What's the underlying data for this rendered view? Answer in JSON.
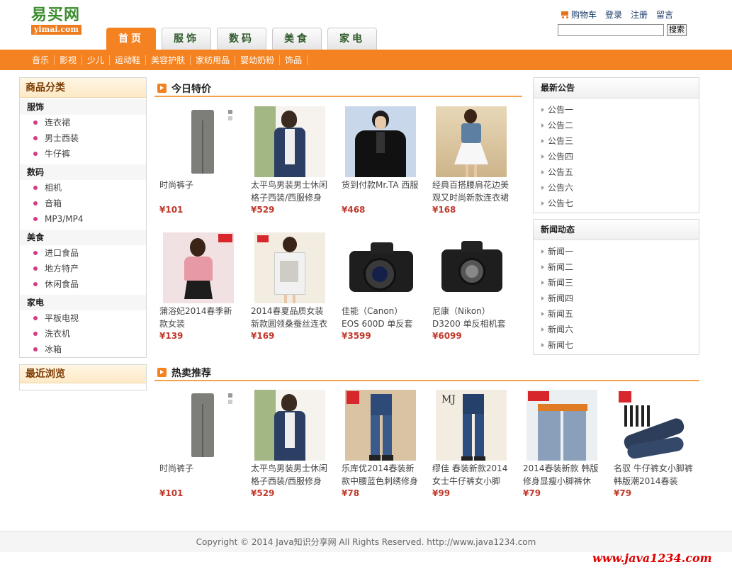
{
  "header": {
    "logo_cn": "易买网",
    "logo_en": "yimai.com",
    "links": [
      "购物车",
      "登录",
      "注册",
      "留言"
    ],
    "search_placeholder": "",
    "search_button": "搜索"
  },
  "tabs": [
    {
      "label": "首页",
      "active": true
    },
    {
      "label": "服饰",
      "active": false
    },
    {
      "label": "数码",
      "active": false
    },
    {
      "label": "美食",
      "active": false
    },
    {
      "label": "家电",
      "active": false
    }
  ],
  "subnav": [
    "音乐",
    "影视",
    "少儿",
    "运动鞋",
    "美容护肤",
    "家纺用品",
    "婴幼奶粉",
    "饰品"
  ],
  "categories": {
    "title": "商品分类",
    "groups": [
      {
        "name": "服饰",
        "items": [
          "连衣裙",
          "男士西装",
          "牛仔裤"
        ]
      },
      {
        "name": "数码",
        "items": [
          "相机",
          "音箱",
          "MP3/MP4"
        ]
      },
      {
        "name": "美食",
        "items": [
          "进口食品",
          "地方特产",
          "休闲食品"
        ]
      },
      {
        "name": "家电",
        "items": [
          "平板电视",
          "洗衣机",
          "冰箱"
        ]
      }
    ]
  },
  "recent": {
    "title": "最近浏览"
  },
  "deals": {
    "title": "今日特价",
    "products": [
      {
        "name": "时尚裤子",
        "price": "¥101"
      },
      {
        "name": "太平鸟男装男士休闲格子西装/西服修身",
        "price": "¥529"
      },
      {
        "name": "货到付款Mr.TA 西服",
        "price": "¥468"
      },
      {
        "name": "经典百搭腰肩花边美观又时尚新款连衣裙",
        "price": "¥168"
      },
      {
        "name": "蒲浴妃2014春季新款女装",
        "price": "¥139"
      },
      {
        "name": "2014春夏品质女装新款圆领桑蚕丝连衣",
        "price": "¥169"
      },
      {
        "name": "佳能（Canon） EOS 600D 单反套机",
        "price": "¥3599"
      },
      {
        "name": "尼康（Nikon） D3200 单反相机套机",
        "price": "¥6099"
      }
    ]
  },
  "hot": {
    "title": "热卖推荐",
    "products": [
      {
        "name": "时尚裤子",
        "price": "¥101"
      },
      {
        "name": "太平鸟男装男士休闲格子西装/西服修身",
        "price": "¥529"
      },
      {
        "name": "乐库优2014春装新款中腰蓝色刺绣修身",
        "price": "¥78"
      },
      {
        "name": "缪佳 春装新款2014女士牛仔裤女小脚",
        "price": "¥99"
      },
      {
        "name": "2014春装新款 韩版修身显瘦小脚裤休",
        "price": "¥79"
      },
      {
        "name": "名驭 牛仔裤女小脚裤韩版潮2014春装",
        "price": "¥79"
      }
    ]
  },
  "notices": {
    "title": "最新公告",
    "items": [
      "公告一",
      "公告二",
      "公告三",
      "公告四",
      "公告五",
      "公告六",
      "公告七"
    ]
  },
  "news": {
    "title": "新闻动态",
    "items": [
      "新闻一",
      "新闻二",
      "新闻三",
      "新闻四",
      "新闻五",
      "新闻六",
      "新闻七"
    ]
  },
  "footer": {
    "copyright": "Copyright © 2014 Java知识分享网 All Rights Reserved. http://www.java1234.com"
  },
  "watermark": "www.java1234.com",
  "colors": {
    "accent": "#f58220",
    "price": "#c0392b",
    "logo_green": "#3b8c2e"
  }
}
